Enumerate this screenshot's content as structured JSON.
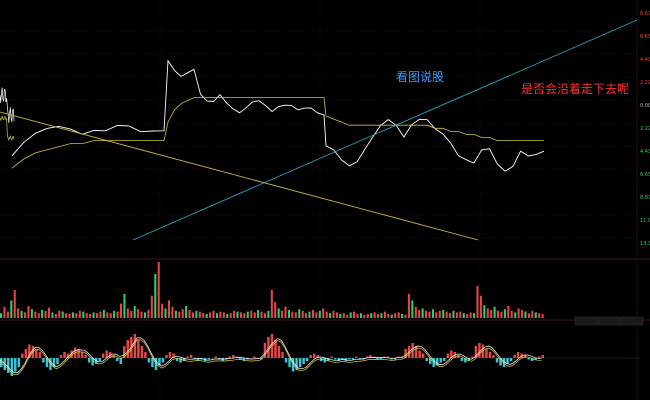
{
  "chart_data": [
    {
      "type": "line",
      "panel": "price",
      "annotations": [
        {
          "text": "看图说股",
          "color": "#3b9cff"
        },
        {
          "text": "是否会沿着走下去呢",
          "color": "#ff3030"
        }
      ],
      "right_axis_labels": [
        {
          "text": "6.67%",
          "color": "#ff3b3b"
        },
        {
          "text": "6.65%",
          "color": "#ff3b3b"
        },
        {
          "text": "4.43%",
          "color": "#ff3b3b"
        },
        {
          "text": "2.22%",
          "color": "#ff3b3b"
        },
        {
          "text": "0.00%",
          "color": "#bbbbbb"
        },
        {
          "text": "2.22%",
          "color": "#2ecc71"
        },
        {
          "text": "4.43%",
          "color": "#2ecc71"
        },
        {
          "text": "6.65%",
          "color": "#2ecc71"
        },
        {
          "text": "8.87%",
          "color": "#2ecc71"
        },
        {
          "text": "11.08%",
          "color": "#2ecc71"
        },
        {
          "text": "13.30%",
          "color": "#2ecc71"
        }
      ],
      "series": [
        {
          "color": "#ffffff",
          "values": [
            62,
            60,
            61,
            58,
            59,
            57,
            60,
            61,
            59,
            60,
            63,
            62,
            64,
            63,
            62,
            61,
            63,
            62,
            62,
            61,
            40,
            36,
            34,
            33,
            32,
            32,
            33,
            32,
            33,
            32,
            32,
            33,
            32,
            32,
            10,
            14,
            16,
            14,
            12,
            20,
            23,
            24,
            22,
            24,
            25,
            26,
            25,
            24,
            24,
            25,
            26,
            24,
            24,
            25,
            27,
            26,
            25,
            26,
            27,
            38,
            40,
            43,
            44,
            42,
            38,
            35,
            32,
            30,
            31,
            34,
            30,
            29,
            30,
            33,
            34,
            36,
            40,
            42,
            44,
            40,
            39,
            43,
            45,
            44,
            40,
            42,
            41,
            39
          ]
        },
        {
          "color": "#d4c43a",
          "values": [
            60,
            60,
            60,
            59,
            59,
            59,
            59,
            59,
            59,
            59,
            60,
            60,
            60,
            60,
            60,
            60,
            60,
            60,
            60,
            60,
            45,
            42,
            40,
            39,
            38,
            37,
            37,
            36,
            36,
            36,
            36,
            36,
            36,
            36,
            30,
            26,
            24,
            23,
            22,
            22,
            22,
            22,
            22,
            22,
            22,
            22,
            22,
            22,
            22,
            22,
            22,
            22,
            22,
            22,
            22,
            22,
            22,
            22,
            22,
            28,
            29,
            30,
            31,
            31,
            31,
            31,
            31,
            31,
            31,
            31,
            31,
            31,
            31,
            32,
            32,
            33,
            33,
            34,
            34,
            35,
            35,
            36,
            36,
            36,
            36,
            36,
            36,
            36
          ]
        }
      ],
      "trendlines": [
        {
          "color": "#c8b93a",
          "from": [
            0,
            74
          ],
          "to": [
            100,
            10
          ]
        },
        {
          "color": "#2aa7c9",
          "from": [
            24,
            2
          ],
          "to": [
            100,
            90
          ]
        }
      ]
    },
    {
      "type": "bar",
      "panel": "volume",
      "up_color": "#e84545",
      "down_color": "#2ecc71",
      "values": [
        6,
        14,
        8,
        22,
        35,
        12,
        9,
        7,
        15,
        11,
        8,
        6,
        10,
        9,
        13,
        7,
        5,
        9,
        8,
        6,
        5,
        7,
        6,
        9,
        8,
        6,
        5,
        7,
        6,
        8,
        10,
        7,
        6,
        9,
        8,
        18,
        30,
        12,
        9,
        15,
        11,
        8,
        7,
        10,
        28,
        55,
        70,
        18,
        12,
        22,
        14,
        9,
        8,
        11,
        15,
        10,
        7,
        9,
        8,
        6,
        5,
        7,
        9,
        6,
        8,
        7,
        5,
        6,
        9,
        8,
        7,
        6,
        8,
        9,
        7,
        10,
        8,
        6,
        9,
        35,
        20,
        12,
        9,
        14,
        10,
        8,
        7,
        11,
        9,
        6,
        8,
        10,
        7,
        9,
        12,
        8,
        6,
        9,
        7,
        5,
        6,
        4,
        7,
        8,
        5,
        6,
        4,
        5,
        6,
        7,
        5,
        6,
        8,
        5,
        4,
        6,
        7,
        5,
        4,
        30,
        22,
        14,
        10,
        12,
        9,
        8,
        11,
        7,
        9,
        10,
        8,
        6,
        9,
        7,
        8,
        6,
        5,
        7,
        6,
        40,
        28,
        16,
        12,
        10,
        14,
        9,
        8,
        11,
        15,
        9,
        7,
        12,
        10,
        8,
        6,
        9,
        7,
        6,
        5
      ]
    },
    {
      "type": "bar",
      "panel": "macd",
      "up_color": "#e84545",
      "down_color": "#36c8d8",
      "values": [
        -6,
        -8,
        -10,
        -12,
        -9,
        -6,
        3,
        6,
        9,
        8,
        6,
        4,
        -3,
        -6,
        -8,
        -6,
        -4,
        2,
        4,
        3,
        5,
        7,
        6,
        4,
        2,
        -3,
        -5,
        -4,
        -2,
        3,
        5,
        4,
        2,
        -2,
        -4,
        8,
        12,
        14,
        16,
        12,
        8,
        4,
        -3,
        -6,
        -8,
        -5,
        -3,
        2,
        4,
        3,
        -2,
        -3,
        -2,
        1,
        2,
        -1,
        -2,
        -1,
        -2,
        -1,
        0,
        1,
        -1,
        -2,
        -1,
        1,
        2,
        1,
        -1,
        -2,
        -1,
        0,
        1,
        0,
        -1,
        10,
        14,
        16,
        12,
        8,
        4,
        -3,
        -6,
        -9,
        -8,
        -6,
        -4,
        -2,
        2,
        3,
        2,
        -2,
        -3,
        -2,
        1,
        -1,
        -2,
        -1,
        -2,
        -1,
        -1,
        1,
        -1,
        -1,
        1,
        2,
        1,
        -1,
        -1,
        1,
        1,
        -1,
        -1,
        1,
        1,
        6,
        8,
        10,
        8,
        5,
        3,
        -2,
        -4,
        -6,
        -5,
        -3,
        -2,
        3,
        5,
        4,
        2,
        -2,
        -3,
        -2,
        1,
        8,
        10,
        9,
        6,
        4,
        2,
        -3,
        -5,
        -6,
        -4,
        -2,
        2,
        4,
        3,
        2,
        -1,
        -2,
        -1,
        1,
        2
      ]
    }
  ]
}
